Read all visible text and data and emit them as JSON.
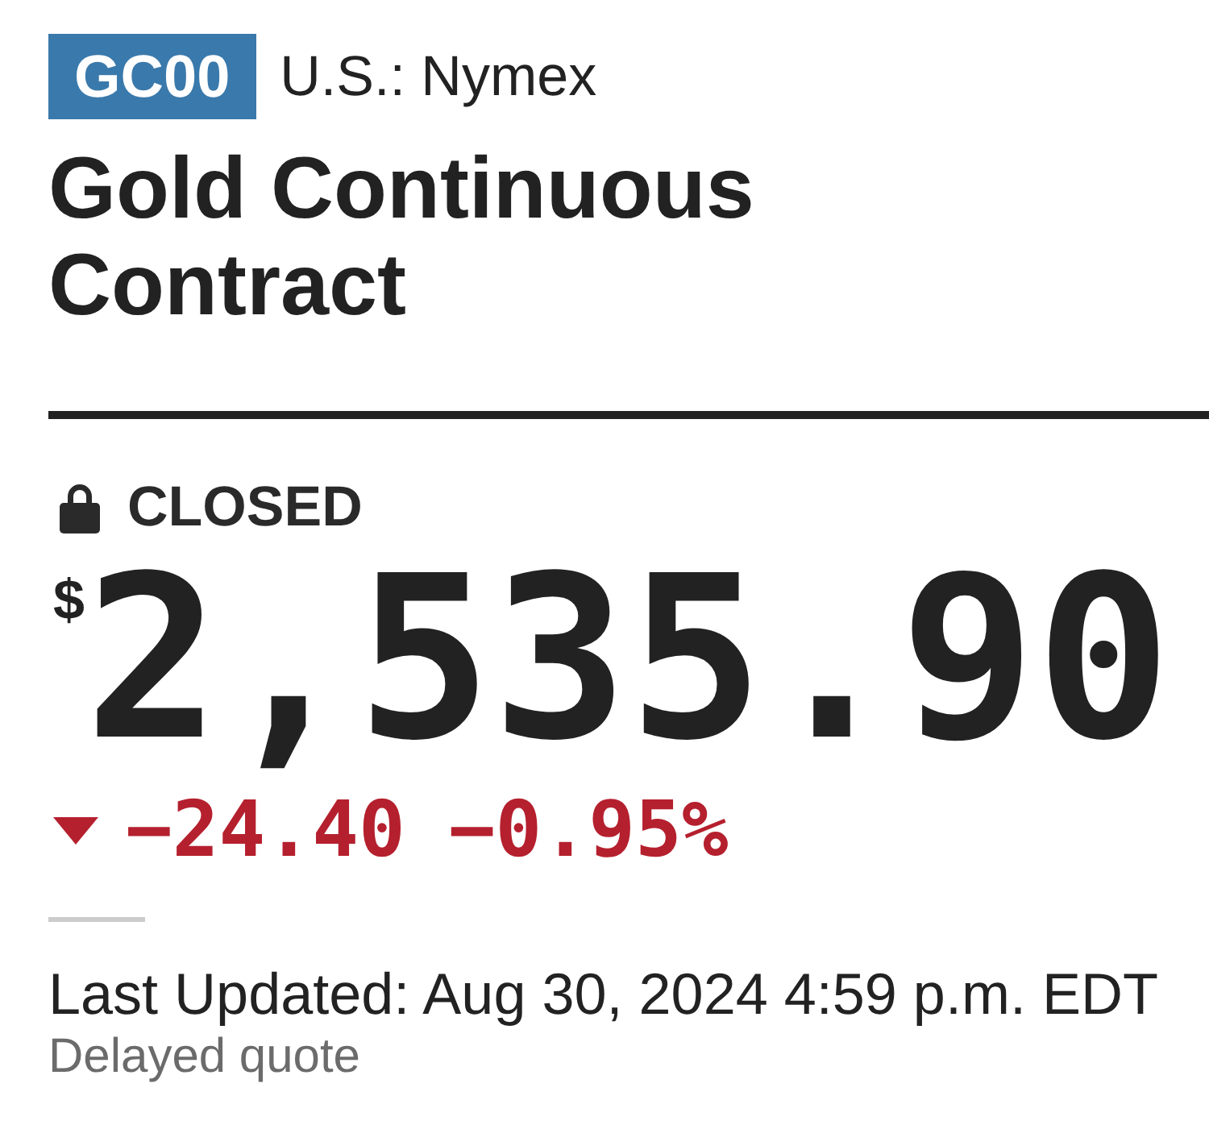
{
  "quote": {
    "ticker": "GC00",
    "exchange": "U.S.: Nymex",
    "name": "Gold Continuous Contract"
  },
  "market_status": {
    "closed": true,
    "label": "CLOSED"
  },
  "price": {
    "currency": "$",
    "value": "2,535.90"
  },
  "change": {
    "down": true,
    "points": "−24.40",
    "percent": "−0.95%"
  },
  "timestamp": {
    "label": "Last Updated: Aug 30, 2024 4:59 p.m. EDT",
    "note": "Delayed quote"
  }
}
